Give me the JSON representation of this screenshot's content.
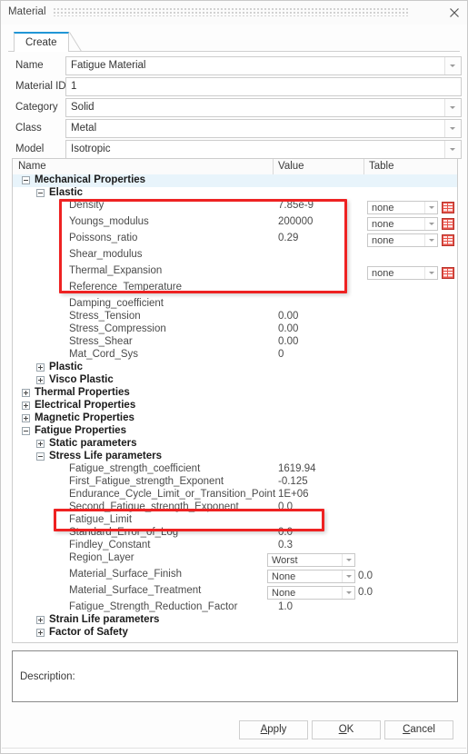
{
  "window": {
    "title": "Material",
    "close_icon": "close-icon"
  },
  "tabs": [
    {
      "label": "Create",
      "active": true
    }
  ],
  "form": {
    "fields": [
      {
        "label": "Name",
        "value": "Fatigue Material",
        "has_dropdown": true
      },
      {
        "label": "Material ID",
        "value": "1",
        "has_dropdown": false
      },
      {
        "label": "Category",
        "value": "Solid",
        "has_dropdown": true
      },
      {
        "label": "Class",
        "value": "Metal",
        "has_dropdown": true
      },
      {
        "label": "Model",
        "value": "Isotropic",
        "has_dropdown": true
      }
    ]
  },
  "tree": {
    "columns": [
      "Name",
      "Value",
      "Table"
    ],
    "rows": [
      {
        "name": "Mechanical Properties",
        "indent": 0,
        "expander": "minus",
        "group": true,
        "selected": true,
        "value": ""
      },
      {
        "name": "Elastic",
        "indent": 1,
        "expander": "minus",
        "group": true,
        "value": ""
      },
      {
        "name": "Density",
        "indent": 2,
        "value": "7.85e-9",
        "table_combo": "none",
        "table_icon": true
      },
      {
        "name": "Youngs_modulus",
        "indent": 2,
        "value": "200000",
        "table_combo": "none",
        "table_icon": true
      },
      {
        "name": "Poissons_ratio",
        "indent": 2,
        "value": "0.29",
        "table_combo": "none",
        "table_icon": true
      },
      {
        "name": "Shear_modulus",
        "indent": 2,
        "value": ""
      },
      {
        "name": "Thermal_Expansion",
        "indent": 2,
        "value": "",
        "table_combo": "none",
        "table_icon": true
      },
      {
        "name": "Reference_Temperature",
        "indent": 2,
        "value": ""
      },
      {
        "name": "Damping_coefficient",
        "indent": 2,
        "value": ""
      },
      {
        "name": "Stress_Tension",
        "indent": 2,
        "value": "0.00"
      },
      {
        "name": "Stress_Compression",
        "indent": 2,
        "value": "0.00"
      },
      {
        "name": "Stress_Shear",
        "indent": 2,
        "value": "0.00"
      },
      {
        "name": "Mat_Cord_Sys",
        "indent": 2,
        "value": "0"
      },
      {
        "name": "Plastic",
        "indent": 1,
        "expander": "plus",
        "group": true,
        "value": ""
      },
      {
        "name": "Visco Plastic",
        "indent": 1,
        "expander": "plus",
        "group": true,
        "value": ""
      },
      {
        "name": "Thermal Properties",
        "indent": 0,
        "expander": "plus",
        "group": true,
        "value": ""
      },
      {
        "name": "Electrical Properties",
        "indent": 0,
        "expander": "plus",
        "group": true,
        "value": ""
      },
      {
        "name": "Magnetic Properties",
        "indent": 0,
        "expander": "plus",
        "group": true,
        "value": ""
      },
      {
        "name": "Fatigue Properties",
        "indent": 0,
        "expander": "minus",
        "group": true,
        "value": ""
      },
      {
        "name": "Static parameters",
        "indent": 1,
        "expander": "plus",
        "group": true,
        "value": ""
      },
      {
        "name": "Stress Life parameters",
        "indent": 1,
        "expander": "minus",
        "group": true,
        "value": ""
      },
      {
        "name": "Fatigue_strength_coefficient",
        "indent": 2,
        "value": "1619.94"
      },
      {
        "name": "First_Fatigue_strength_Exponent",
        "indent": 2,
        "value": "-0.125"
      },
      {
        "name": "Endurance_Cycle_Limit_or_Transition_Point",
        "indent": 2,
        "value": "1E+06"
      },
      {
        "name": "Second_Fatigue_strength_Exponent",
        "indent": 2,
        "value": "0.0"
      },
      {
        "name": "Fatigue_Limit",
        "indent": 2,
        "value": ""
      },
      {
        "name": "Standard_Error_of_Log",
        "indent": 2,
        "value": "0.0"
      },
      {
        "name": "Findley_Constant",
        "indent": 2,
        "value": "0.3"
      },
      {
        "name": "Region_Layer",
        "indent": 2,
        "value": "",
        "value_combo": "Worst"
      },
      {
        "name": "Material_Surface_Finish",
        "indent": 2,
        "value": "",
        "value_combo": "None",
        "side_text": "0.0"
      },
      {
        "name": "Material_Surface_Treatment",
        "indent": 2,
        "value": "",
        "value_combo": "None",
        "side_text": "0.0"
      },
      {
        "name": "Fatigue_Strength_Reduction_Factor",
        "indent": 2,
        "value": "1.0"
      },
      {
        "name": "Strain Life parameters",
        "indent": 1,
        "expander": "plus",
        "group": true,
        "value": ""
      },
      {
        "name": "Factor of Safety",
        "indent": 1,
        "expander": "plus",
        "group": true,
        "value": ""
      }
    ]
  },
  "annotations": {
    "highlight_color": "#ee2222",
    "boxes": [
      {
        "label": "elastic-properties-highlight"
      },
      {
        "label": "fatigue-limit-highlight"
      }
    ]
  },
  "description": {
    "label": "Description:",
    "value": ""
  },
  "buttons": [
    {
      "name": "apply-button",
      "prefix": "",
      "mnemonic": "A",
      "suffix": "pply"
    },
    {
      "name": "ok-button",
      "prefix": "",
      "mnemonic": "O",
      "suffix": "K"
    },
    {
      "name": "cancel-button",
      "prefix": "",
      "mnemonic": "C",
      "suffix": "ancel"
    }
  ]
}
